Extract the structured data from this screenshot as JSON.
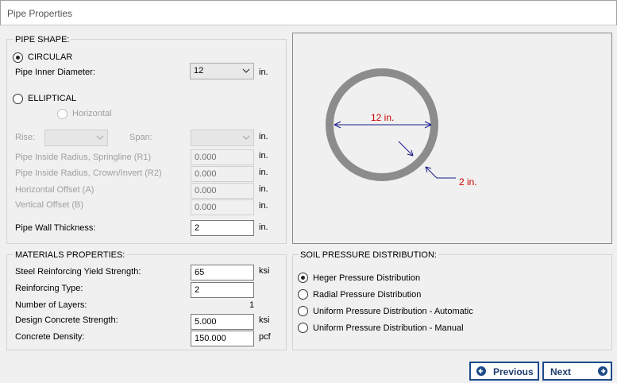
{
  "window": {
    "title": "Pipe Properties"
  },
  "pipe_shape": {
    "group_label": "PIPE SHAPE:",
    "circular_label": "CIRCULAR",
    "inner_diameter_label": "Pipe Inner Diameter:",
    "inner_diameter_value": "12",
    "inner_diameter_unit": "in.",
    "elliptical_label": "ELLIPTICAL",
    "horizontal_label": "Horizontal",
    "rise_label": "Rise:",
    "span_label": "Span:",
    "span_unit": "in.",
    "r1_label": "Pipe Inside Radius, Springline (R1)",
    "r1_value": "0.000",
    "r1_unit": "in.",
    "r2_label": "Pipe Inside Radius, Crown/Invert (R2)",
    "r2_value": "0.000",
    "r2_unit": "in.",
    "h_offset_label": "Horizontal Offset (A)",
    "h_offset_value": "0.000",
    "h_offset_unit": "in.",
    "v_offset_label": "Vertical Offset (B)",
    "v_offset_value": "0.000",
    "v_offset_unit": "in.",
    "wall_label": "Pipe Wall Thickness:",
    "wall_value": "2",
    "wall_unit": "in."
  },
  "preview": {
    "diameter_annotation": "12 in.",
    "wall_annotation": "2 in.",
    "ring_color": "#8c8c8c",
    "dimension_color": "#1a1a8c",
    "annotation_color": "#cc0000"
  },
  "materials": {
    "group_label": "MATERIALS PROPERTIES:",
    "steel_label": "Steel Reinforcing Yield Strength:",
    "steel_value": "65",
    "steel_unit": "ksi",
    "reinf_type_label": "Reinforcing Type:",
    "reinf_type_value": "2",
    "layers_label": "Number of Layers:",
    "layers_value": "1",
    "concrete_strength_label": "Design Concrete Strength:",
    "concrete_strength_value": "5.000",
    "concrete_strength_unit": "ksi",
    "density_label": "Concrete Density:",
    "density_value": "150.000",
    "density_unit": "pcf"
  },
  "soil": {
    "group_label": "SOIL PRESSURE DISTRIBUTION:",
    "options": [
      "Heger Pressure Distribution",
      "Radial Pressure Distribution",
      "Uniform Pressure Distribution - Automatic",
      "Uniform Pressure Distribution - Manual"
    ]
  },
  "nav": {
    "previous_label": "Previous",
    "next_label": "Next",
    "accent_color": "#1e4a8a"
  }
}
